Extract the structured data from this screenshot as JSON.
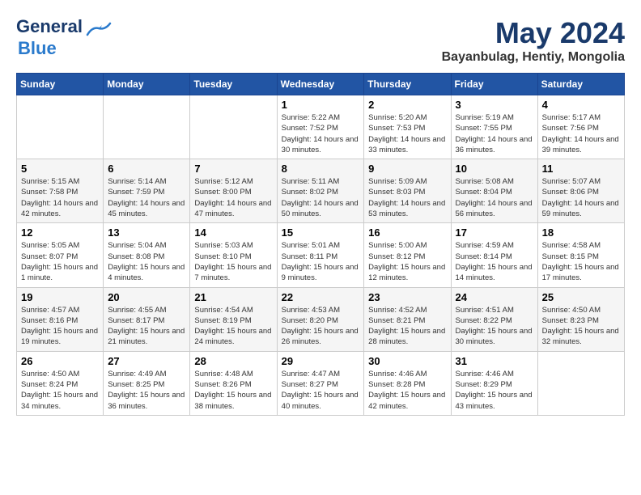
{
  "logo": {
    "line1": "General",
    "line2": "Blue"
  },
  "title": "May 2024",
  "location": "Bayanbulag, Hentiy, Mongolia",
  "weekdays": [
    "Sunday",
    "Monday",
    "Tuesday",
    "Wednesday",
    "Thursday",
    "Friday",
    "Saturday"
  ],
  "weeks": [
    [
      {
        "day": "",
        "sunrise": "",
        "sunset": "",
        "daylight": ""
      },
      {
        "day": "",
        "sunrise": "",
        "sunset": "",
        "daylight": ""
      },
      {
        "day": "",
        "sunrise": "",
        "sunset": "",
        "daylight": ""
      },
      {
        "day": "1",
        "sunrise": "Sunrise: 5:22 AM",
        "sunset": "Sunset: 7:52 PM",
        "daylight": "Daylight: 14 hours and 30 minutes."
      },
      {
        "day": "2",
        "sunrise": "Sunrise: 5:20 AM",
        "sunset": "Sunset: 7:53 PM",
        "daylight": "Daylight: 14 hours and 33 minutes."
      },
      {
        "day": "3",
        "sunrise": "Sunrise: 5:19 AM",
        "sunset": "Sunset: 7:55 PM",
        "daylight": "Daylight: 14 hours and 36 minutes."
      },
      {
        "day": "4",
        "sunrise": "Sunrise: 5:17 AM",
        "sunset": "Sunset: 7:56 PM",
        "daylight": "Daylight: 14 hours and 39 minutes."
      }
    ],
    [
      {
        "day": "5",
        "sunrise": "Sunrise: 5:15 AM",
        "sunset": "Sunset: 7:58 PM",
        "daylight": "Daylight: 14 hours and 42 minutes."
      },
      {
        "day": "6",
        "sunrise": "Sunrise: 5:14 AM",
        "sunset": "Sunset: 7:59 PM",
        "daylight": "Daylight: 14 hours and 45 minutes."
      },
      {
        "day": "7",
        "sunrise": "Sunrise: 5:12 AM",
        "sunset": "Sunset: 8:00 PM",
        "daylight": "Daylight: 14 hours and 47 minutes."
      },
      {
        "day": "8",
        "sunrise": "Sunrise: 5:11 AM",
        "sunset": "Sunset: 8:02 PM",
        "daylight": "Daylight: 14 hours and 50 minutes."
      },
      {
        "day": "9",
        "sunrise": "Sunrise: 5:09 AM",
        "sunset": "Sunset: 8:03 PM",
        "daylight": "Daylight: 14 hours and 53 minutes."
      },
      {
        "day": "10",
        "sunrise": "Sunrise: 5:08 AM",
        "sunset": "Sunset: 8:04 PM",
        "daylight": "Daylight: 14 hours and 56 minutes."
      },
      {
        "day": "11",
        "sunrise": "Sunrise: 5:07 AM",
        "sunset": "Sunset: 8:06 PM",
        "daylight": "Daylight: 14 hours and 59 minutes."
      }
    ],
    [
      {
        "day": "12",
        "sunrise": "Sunrise: 5:05 AM",
        "sunset": "Sunset: 8:07 PM",
        "daylight": "Daylight: 15 hours and 1 minute."
      },
      {
        "day": "13",
        "sunrise": "Sunrise: 5:04 AM",
        "sunset": "Sunset: 8:08 PM",
        "daylight": "Daylight: 15 hours and 4 minutes."
      },
      {
        "day": "14",
        "sunrise": "Sunrise: 5:03 AM",
        "sunset": "Sunset: 8:10 PM",
        "daylight": "Daylight: 15 hours and 7 minutes."
      },
      {
        "day": "15",
        "sunrise": "Sunrise: 5:01 AM",
        "sunset": "Sunset: 8:11 PM",
        "daylight": "Daylight: 15 hours and 9 minutes."
      },
      {
        "day": "16",
        "sunrise": "Sunrise: 5:00 AM",
        "sunset": "Sunset: 8:12 PM",
        "daylight": "Daylight: 15 hours and 12 minutes."
      },
      {
        "day": "17",
        "sunrise": "Sunrise: 4:59 AM",
        "sunset": "Sunset: 8:14 PM",
        "daylight": "Daylight: 15 hours and 14 minutes."
      },
      {
        "day": "18",
        "sunrise": "Sunrise: 4:58 AM",
        "sunset": "Sunset: 8:15 PM",
        "daylight": "Daylight: 15 hours and 17 minutes."
      }
    ],
    [
      {
        "day": "19",
        "sunrise": "Sunrise: 4:57 AM",
        "sunset": "Sunset: 8:16 PM",
        "daylight": "Daylight: 15 hours and 19 minutes."
      },
      {
        "day": "20",
        "sunrise": "Sunrise: 4:55 AM",
        "sunset": "Sunset: 8:17 PM",
        "daylight": "Daylight: 15 hours and 21 minutes."
      },
      {
        "day": "21",
        "sunrise": "Sunrise: 4:54 AM",
        "sunset": "Sunset: 8:19 PM",
        "daylight": "Daylight: 15 hours and 24 minutes."
      },
      {
        "day": "22",
        "sunrise": "Sunrise: 4:53 AM",
        "sunset": "Sunset: 8:20 PM",
        "daylight": "Daylight: 15 hours and 26 minutes."
      },
      {
        "day": "23",
        "sunrise": "Sunrise: 4:52 AM",
        "sunset": "Sunset: 8:21 PM",
        "daylight": "Daylight: 15 hours and 28 minutes."
      },
      {
        "day": "24",
        "sunrise": "Sunrise: 4:51 AM",
        "sunset": "Sunset: 8:22 PM",
        "daylight": "Daylight: 15 hours and 30 minutes."
      },
      {
        "day": "25",
        "sunrise": "Sunrise: 4:50 AM",
        "sunset": "Sunset: 8:23 PM",
        "daylight": "Daylight: 15 hours and 32 minutes."
      }
    ],
    [
      {
        "day": "26",
        "sunrise": "Sunrise: 4:50 AM",
        "sunset": "Sunset: 8:24 PM",
        "daylight": "Daylight: 15 hours and 34 minutes."
      },
      {
        "day": "27",
        "sunrise": "Sunrise: 4:49 AM",
        "sunset": "Sunset: 8:25 PM",
        "daylight": "Daylight: 15 hours and 36 minutes."
      },
      {
        "day": "28",
        "sunrise": "Sunrise: 4:48 AM",
        "sunset": "Sunset: 8:26 PM",
        "daylight": "Daylight: 15 hours and 38 minutes."
      },
      {
        "day": "29",
        "sunrise": "Sunrise: 4:47 AM",
        "sunset": "Sunset: 8:27 PM",
        "daylight": "Daylight: 15 hours and 40 minutes."
      },
      {
        "day": "30",
        "sunrise": "Sunrise: 4:46 AM",
        "sunset": "Sunset: 8:28 PM",
        "daylight": "Daylight: 15 hours and 42 minutes."
      },
      {
        "day": "31",
        "sunrise": "Sunrise: 4:46 AM",
        "sunset": "Sunset: 8:29 PM",
        "daylight": "Daylight: 15 hours and 43 minutes."
      },
      {
        "day": "",
        "sunrise": "",
        "sunset": "",
        "daylight": ""
      }
    ]
  ]
}
